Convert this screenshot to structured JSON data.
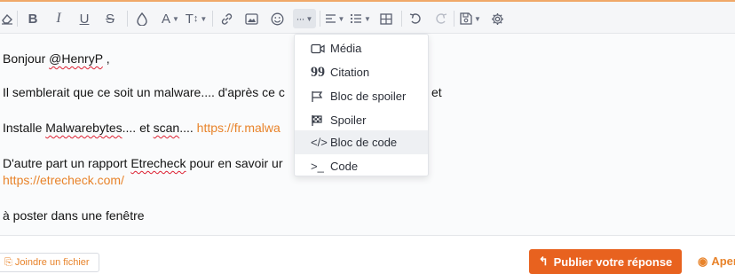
{
  "editor": {
    "greeting_prefix": "Bonjour ",
    "greeting_mention": "@HenryP",
    "greeting_suffix": " ,",
    "line2_visible": "Il semblerait que ce soit un malware.... d'après ce c",
    "line2_tail": "et",
    "line3_prefix": "Installe ",
    "line3_word1": "Malwarebytes",
    "line3_mid": ".... et ",
    "line3_word2": "scan",
    "line3_after": "....  ",
    "line3_link": "https://fr.malwa",
    "line4_prefix": "D'autre part un rapport ",
    "line4_word": "Etrecheck",
    "line4_suffix": " pour en savoir ur",
    "line5_link": "https://etrecheck.com/",
    "line6": "à poster dans une fenêtre"
  },
  "insert_menu": {
    "items": [
      {
        "label": "Média",
        "icon": "video-icon"
      },
      {
        "label": "Citation",
        "icon": "quote-icon"
      },
      {
        "label": "Bloc de spoiler",
        "icon": "flag-icon"
      },
      {
        "label": "Spoiler",
        "icon": "checkered-flag-icon"
      },
      {
        "label": "Bloc de code",
        "icon": "code-brackets-icon"
      },
      {
        "label": "Code",
        "icon": "terminal-icon"
      }
    ],
    "hovered": "Bloc de code"
  },
  "toolbar": {
    "bold": "B",
    "italic": "I",
    "underline": "U",
    "strike": "S",
    "font_color": "A",
    "font_size": "T",
    "more": "···"
  },
  "footer": {
    "attach_label": "Joindre un fichier",
    "publish_label": "Publier votre réponse",
    "preview_label": "Aper"
  },
  "colors": {
    "accent": "#e8832a",
    "publish_bg": "#e8621f",
    "toolbar_border": "#f0a868"
  }
}
